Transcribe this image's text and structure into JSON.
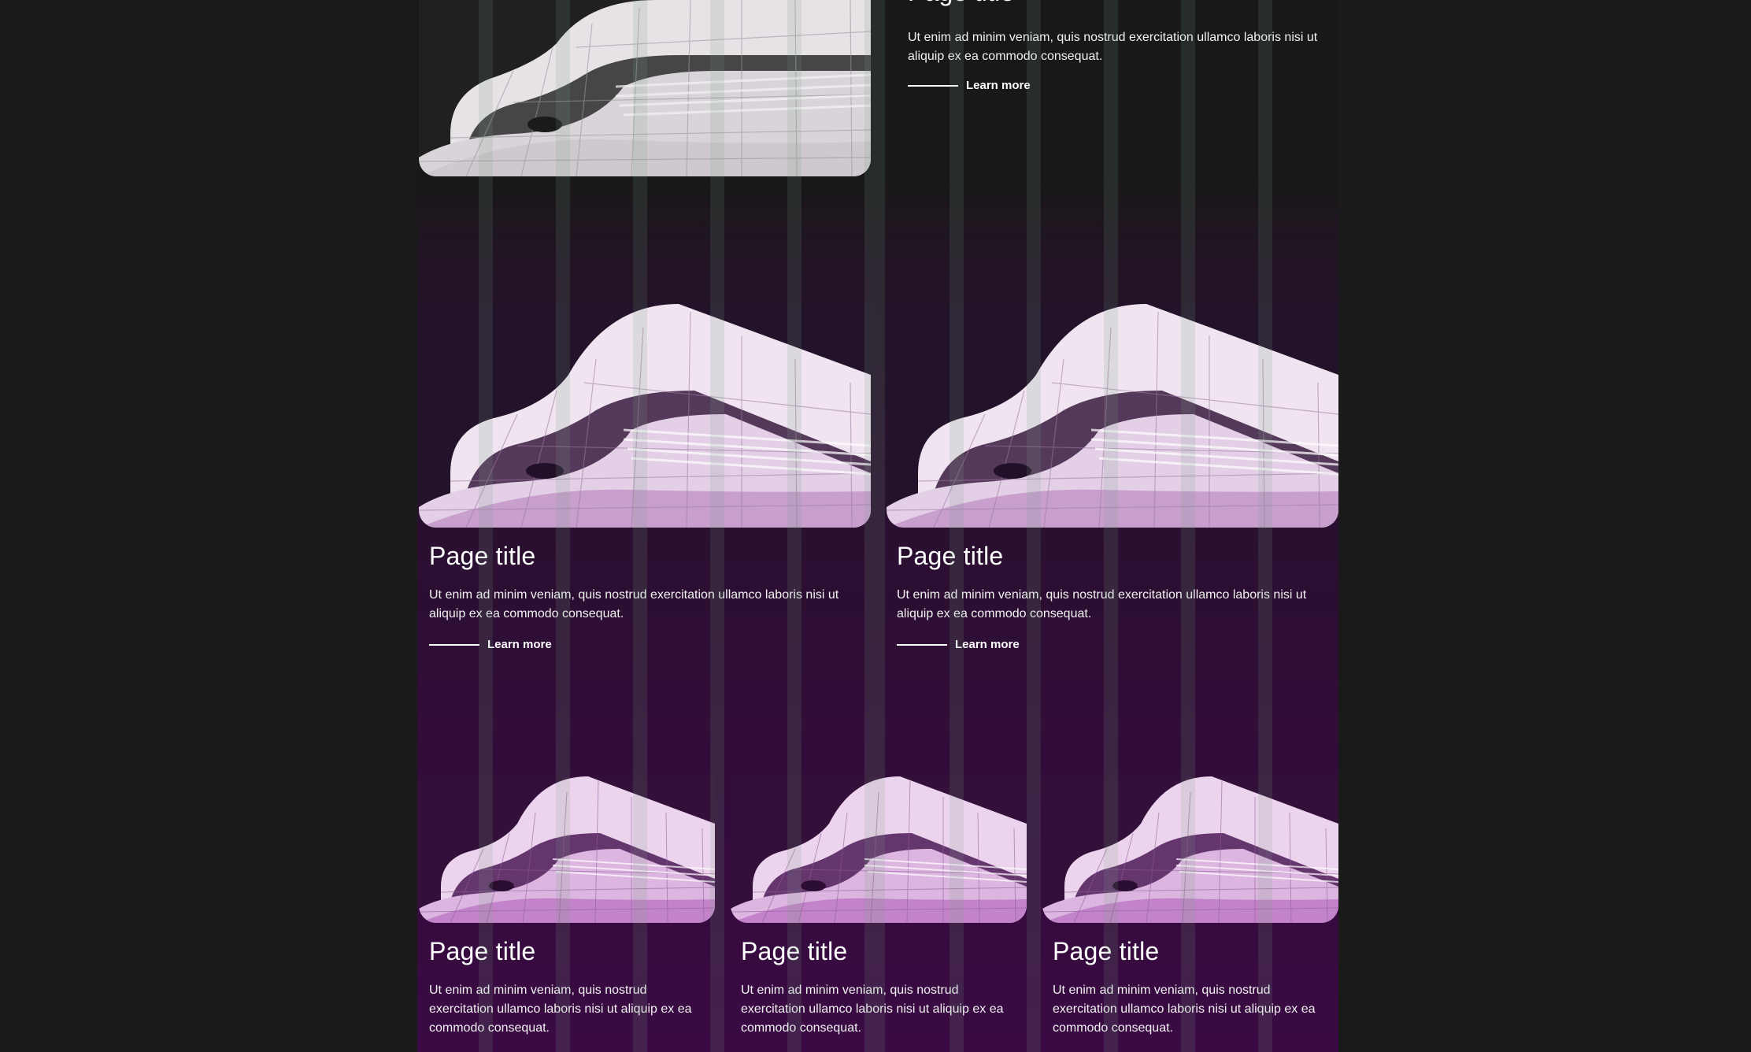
{
  "colors": {
    "page_background": "#1a1a1a",
    "panel_top": "#181818",
    "panel_bottom": "#3b0a44",
    "text": "#ffffff",
    "image_tint_light": "#f2eef2",
    "image_tint_mid": "#e8cdea",
    "image_tint_strong": "#c98fd0"
  },
  "cards": [
    {
      "image_icon": "curved-building-image",
      "title": "Page title",
      "description": "Ut enim ad minim veniam, quis nostrud exercitation ullamco laboris nisi ut aliquip ex ea commodo consequat.",
      "link_label": "Learn more"
    },
    {
      "image_icon": "curved-building-image",
      "title": "Page title",
      "description": "Ut enim ad minim veniam, quis nostrud exercitation ullamco laboris nisi ut aliquip ex ea commodo consequat.",
      "link_label": "Learn more"
    },
    {
      "image_icon": "curved-building-image",
      "title": "Page title",
      "description": "Ut enim ad minim veniam, quis nostrud exercitation ullamco laboris nisi ut aliquip ex ea commodo consequat.",
      "link_label": "Learn more"
    },
    {
      "image_icon": "curved-building-image",
      "title": "Page title",
      "description": "Ut enim ad minim veniam, quis nostrud exercitation ullamco laboris nisi ut aliquip ex ea commodo consequat."
    },
    {
      "image_icon": "curved-building-image",
      "title": "Page title",
      "description": "Ut enim ad minim veniam, quis nostrud exercitation ullamco laboris nisi ut aliquip ex ea commodo consequat."
    },
    {
      "image_icon": "curved-building-image",
      "title": "Page title",
      "description": "Ut enim ad minim veniam, quis nostrud exercitation ullamco laboris nisi ut aliquip ex ea commodo consequat."
    }
  ]
}
